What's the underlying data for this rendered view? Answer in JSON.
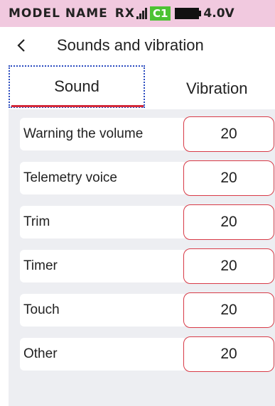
{
  "status": {
    "model_name": "MODEL NAME",
    "rx_label": "RX",
    "channel_badge": "C1",
    "voltage": "4.0V",
    "colors": {
      "bar": "#f1c9df",
      "badge": "#4cc233"
    }
  },
  "header": {
    "back_icon": "chevron-left-icon",
    "title": "Sounds and vibration"
  },
  "tabs": [
    {
      "label": "Sound",
      "active": true
    },
    {
      "label": "Vibration",
      "active": false
    }
  ],
  "settings": [
    {
      "label": "Warning the volume",
      "value": "20"
    },
    {
      "label": "Telemetry voice",
      "value": "20"
    },
    {
      "label": "Trim",
      "value": "20"
    },
    {
      "label": "Timer",
      "value": "20"
    },
    {
      "label": "Touch",
      "value": "20"
    },
    {
      "label": "Other",
      "value": "20"
    }
  ],
  "accent_color": "#d42a3a"
}
